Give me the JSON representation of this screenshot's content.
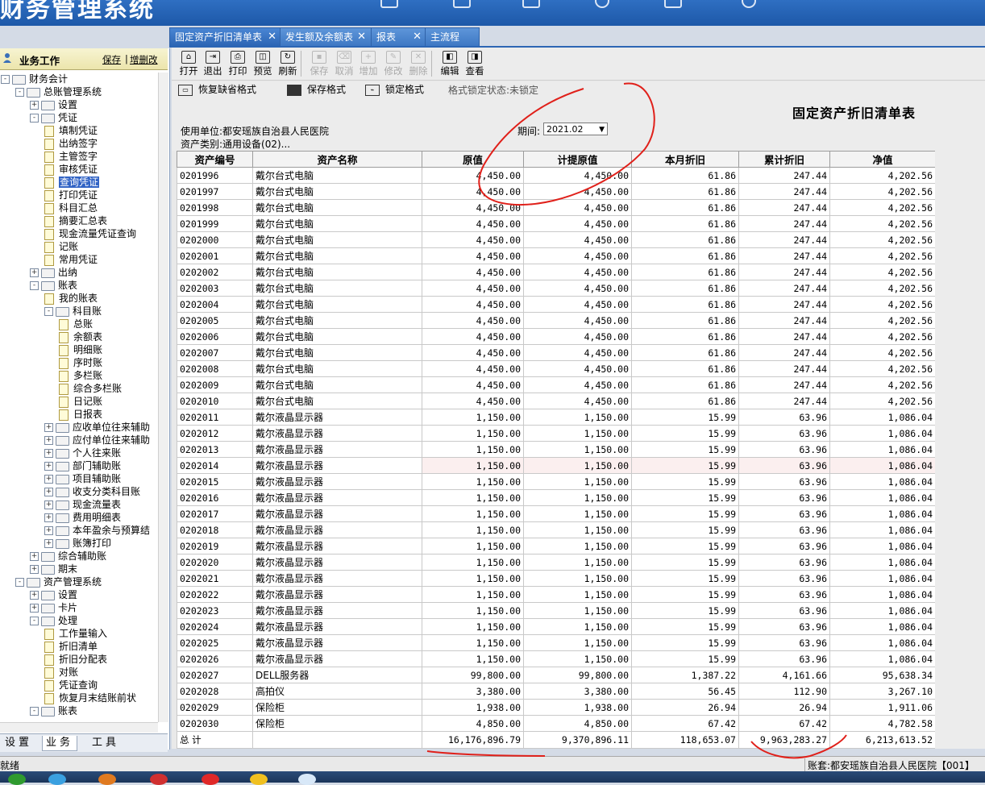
{
  "app": {
    "title": "财务管理系统"
  },
  "sidebar": {
    "title": "业务工作",
    "save_link": "保存",
    "separator": "|",
    "edit_link": "增删改",
    "tree": [
      {
        "label": "财务会计",
        "level": 0,
        "type": "folder",
        "exp": "-"
      },
      {
        "label": "总账管理系统",
        "level": 1,
        "type": "folder",
        "exp": "-"
      },
      {
        "label": "设置",
        "level": 2,
        "type": "folder",
        "exp": "+"
      },
      {
        "label": "凭证",
        "level": 2,
        "type": "folder",
        "exp": "-"
      },
      {
        "label": "填制凭证",
        "level": 3,
        "type": "doc"
      },
      {
        "label": "出纳签字",
        "level": 3,
        "type": "doc"
      },
      {
        "label": "主管签字",
        "level": 3,
        "type": "doc"
      },
      {
        "label": "审核凭证",
        "level": 3,
        "type": "doc"
      },
      {
        "label": "查询凭证",
        "level": 3,
        "type": "doc",
        "selected": true
      },
      {
        "label": "打印凭证",
        "level": 3,
        "type": "doc"
      },
      {
        "label": "科目汇总",
        "level": 3,
        "type": "doc"
      },
      {
        "label": "摘要汇总表",
        "level": 3,
        "type": "doc"
      },
      {
        "label": "现金流量凭证查询",
        "level": 3,
        "type": "doc"
      },
      {
        "label": "记账",
        "level": 3,
        "type": "doc"
      },
      {
        "label": "常用凭证",
        "level": 3,
        "type": "doc"
      },
      {
        "label": "出纳",
        "level": 2,
        "type": "folder",
        "exp": "+"
      },
      {
        "label": "账表",
        "level": 2,
        "type": "folder",
        "exp": "-"
      },
      {
        "label": "我的账表",
        "level": 3,
        "type": "doc"
      },
      {
        "label": "科目账",
        "level": 3,
        "type": "folder",
        "exp": "-"
      },
      {
        "label": "总账",
        "level": 4,
        "type": "doc"
      },
      {
        "label": "余额表",
        "level": 4,
        "type": "doc"
      },
      {
        "label": "明细账",
        "level": 4,
        "type": "doc"
      },
      {
        "label": "序时账",
        "level": 4,
        "type": "doc"
      },
      {
        "label": "多栏账",
        "level": 4,
        "type": "doc"
      },
      {
        "label": "综合多栏账",
        "level": 4,
        "type": "doc"
      },
      {
        "label": "日记账",
        "level": 4,
        "type": "doc"
      },
      {
        "label": "日报表",
        "level": 4,
        "type": "doc"
      },
      {
        "label": "应收单位往来辅助",
        "level": 3,
        "type": "folder",
        "exp": "+"
      },
      {
        "label": "应付单位往来辅助",
        "level": 3,
        "type": "folder",
        "exp": "+"
      },
      {
        "label": "个人往来账",
        "level": 3,
        "type": "folder",
        "exp": "+"
      },
      {
        "label": "部门辅助账",
        "level": 3,
        "type": "folder",
        "exp": "+"
      },
      {
        "label": "项目辅助账",
        "level": 3,
        "type": "folder",
        "exp": "+"
      },
      {
        "label": "收支分类科目账",
        "level": 3,
        "type": "folder",
        "exp": "+"
      },
      {
        "label": "现金流量表",
        "level": 3,
        "type": "folder",
        "exp": "+"
      },
      {
        "label": "费用明细表",
        "level": 3,
        "type": "folder",
        "exp": "+"
      },
      {
        "label": "本年盈余与预算结",
        "level": 3,
        "type": "folder",
        "exp": "+"
      },
      {
        "label": "账簿打印",
        "level": 3,
        "type": "folder",
        "exp": "+"
      },
      {
        "label": "综合辅助账",
        "level": 2,
        "type": "folder",
        "exp": "+"
      },
      {
        "label": "期末",
        "level": 2,
        "type": "folder",
        "exp": "+"
      },
      {
        "label": "资产管理系统",
        "level": 1,
        "type": "folder",
        "exp": "-"
      },
      {
        "label": "设置",
        "level": 2,
        "type": "folder",
        "exp": "+"
      },
      {
        "label": "卡片",
        "level": 2,
        "type": "folder",
        "exp": "+"
      },
      {
        "label": "处理",
        "level": 2,
        "type": "folder",
        "exp": "-"
      },
      {
        "label": "工作量输入",
        "level": 3,
        "type": "doc"
      },
      {
        "label": "折旧清单",
        "level": 3,
        "type": "doc"
      },
      {
        "label": "折旧分配表",
        "level": 3,
        "type": "doc"
      },
      {
        "label": "对账",
        "level": 3,
        "type": "doc"
      },
      {
        "label": "凭证查询",
        "level": 3,
        "type": "doc"
      },
      {
        "label": "恢复月末结账前状",
        "level": 3,
        "type": "doc"
      },
      {
        "label": "账表",
        "level": 2,
        "type": "folder",
        "exp": "-"
      }
    ],
    "bottom_tabs": [
      "设置",
      "业务",
      "工具"
    ],
    "active_tab": 1
  },
  "doc_tabs": [
    {
      "label": "固定资产折旧清单表",
      "active": true
    },
    {
      "label": "发生额及余额表"
    },
    {
      "label": "报表"
    },
    {
      "label": "主流程",
      "no_close": true
    }
  ],
  "toolbar": [
    {
      "label": "打开",
      "icon": "open-icon"
    },
    {
      "label": "退出",
      "icon": "exit-icon"
    },
    {
      "label": "打印",
      "icon": "print-icon"
    },
    {
      "label": "预览",
      "icon": "preview-icon"
    },
    {
      "label": "刷新",
      "icon": "refresh-icon"
    },
    {
      "label": "保存",
      "icon": "save-icon",
      "disabled": true
    },
    {
      "label": "取消",
      "icon": "cancel-icon",
      "disabled": true
    },
    {
      "label": "增加",
      "icon": "add-icon",
      "disabled": true
    },
    {
      "label": "修改",
      "icon": "edit-icon",
      "disabled": true
    },
    {
      "label": "删除",
      "icon": "delete-icon",
      "disabled": true
    },
    {
      "label": "编辑",
      "icon": "design-icon"
    },
    {
      "label": "查看",
      "icon": "view-icon"
    }
  ],
  "format_bar": {
    "restore_label": "恢复缺省格式",
    "save_label": "保存格式",
    "lock_label": "锁定格式",
    "status": "格式锁定状态:未锁定"
  },
  "report": {
    "title": "固定资产折旧清单表",
    "unit": "使用单位:都安瑶族自治县人民医院",
    "period_label": "期间:",
    "period_value": "2021.02",
    "category": "资产类别:通用设备(02)..."
  },
  "table": {
    "columns": [
      "资产编号",
      "资产名称",
      "原值",
      "计提原值",
      "本月折旧",
      "累计折旧",
      "净值"
    ],
    "rows": [
      [
        "0201996",
        "戴尔台式电脑",
        "4,450.00",
        "4,450.00",
        "61.86",
        "247.44",
        "4,202.56"
      ],
      [
        "0201997",
        "戴尔台式电脑",
        "4,450.00",
        "4,450.00",
        "61.86",
        "247.44",
        "4,202.56"
      ],
      [
        "0201998",
        "戴尔台式电脑",
        "4,450.00",
        "4,450.00",
        "61.86",
        "247.44",
        "4,202.56"
      ],
      [
        "0201999",
        "戴尔台式电脑",
        "4,450.00",
        "4,450.00",
        "61.86",
        "247.44",
        "4,202.56"
      ],
      [
        "0202000",
        "戴尔台式电脑",
        "4,450.00",
        "4,450.00",
        "61.86",
        "247.44",
        "4,202.56"
      ],
      [
        "0202001",
        "戴尔台式电脑",
        "4,450.00",
        "4,450.00",
        "61.86",
        "247.44",
        "4,202.56"
      ],
      [
        "0202002",
        "戴尔台式电脑",
        "4,450.00",
        "4,450.00",
        "61.86",
        "247.44",
        "4,202.56"
      ],
      [
        "0202003",
        "戴尔台式电脑",
        "4,450.00",
        "4,450.00",
        "61.86",
        "247.44",
        "4,202.56"
      ],
      [
        "0202004",
        "戴尔台式电脑",
        "4,450.00",
        "4,450.00",
        "61.86",
        "247.44",
        "4,202.56"
      ],
      [
        "0202005",
        "戴尔台式电脑",
        "4,450.00",
        "4,450.00",
        "61.86",
        "247.44",
        "4,202.56"
      ],
      [
        "0202006",
        "戴尔台式电脑",
        "4,450.00",
        "4,450.00",
        "61.86",
        "247.44",
        "4,202.56"
      ],
      [
        "0202007",
        "戴尔台式电脑",
        "4,450.00",
        "4,450.00",
        "61.86",
        "247.44",
        "4,202.56"
      ],
      [
        "0202008",
        "戴尔台式电脑",
        "4,450.00",
        "4,450.00",
        "61.86",
        "247.44",
        "4,202.56"
      ],
      [
        "0202009",
        "戴尔台式电脑",
        "4,450.00",
        "4,450.00",
        "61.86",
        "247.44",
        "4,202.56"
      ],
      [
        "0202010",
        "戴尔台式电脑",
        "4,450.00",
        "4,450.00",
        "61.86",
        "247.44",
        "4,202.56"
      ],
      [
        "0202011",
        "戴尔液晶显示器",
        "1,150.00",
        "1,150.00",
        "15.99",
        "63.96",
        "1,086.04"
      ],
      [
        "0202012",
        "戴尔液晶显示器",
        "1,150.00",
        "1,150.00",
        "15.99",
        "63.96",
        "1,086.04"
      ],
      [
        "0202013",
        "戴尔液晶显示器",
        "1,150.00",
        "1,150.00",
        "15.99",
        "63.96",
        "1,086.04"
      ],
      [
        "0202014",
        "戴尔液晶显示器",
        "1,150.00",
        "1,150.00",
        "15.99",
        "63.96",
        "1,086.04"
      ],
      [
        "0202015",
        "戴尔液晶显示器",
        "1,150.00",
        "1,150.00",
        "15.99",
        "63.96",
        "1,086.04"
      ],
      [
        "0202016",
        "戴尔液晶显示器",
        "1,150.00",
        "1,150.00",
        "15.99",
        "63.96",
        "1,086.04"
      ],
      [
        "0202017",
        "戴尔液晶显示器",
        "1,150.00",
        "1,150.00",
        "15.99",
        "63.96",
        "1,086.04"
      ],
      [
        "0202018",
        "戴尔液晶显示器",
        "1,150.00",
        "1,150.00",
        "15.99",
        "63.96",
        "1,086.04"
      ],
      [
        "0202019",
        "戴尔液晶显示器",
        "1,150.00",
        "1,150.00",
        "15.99",
        "63.96",
        "1,086.04"
      ],
      [
        "0202020",
        "戴尔液晶显示器",
        "1,150.00",
        "1,150.00",
        "15.99",
        "63.96",
        "1,086.04"
      ],
      [
        "0202021",
        "戴尔液晶显示器",
        "1,150.00",
        "1,150.00",
        "15.99",
        "63.96",
        "1,086.04"
      ],
      [
        "0202022",
        "戴尔液晶显示器",
        "1,150.00",
        "1,150.00",
        "15.99",
        "63.96",
        "1,086.04"
      ],
      [
        "0202023",
        "戴尔液晶显示器",
        "1,150.00",
        "1,150.00",
        "15.99",
        "63.96",
        "1,086.04"
      ],
      [
        "0202024",
        "戴尔液晶显示器",
        "1,150.00",
        "1,150.00",
        "15.99",
        "63.96",
        "1,086.04"
      ],
      [
        "0202025",
        "戴尔液晶显示器",
        "1,150.00",
        "1,150.00",
        "15.99",
        "63.96",
        "1,086.04"
      ],
      [
        "0202026",
        "戴尔液晶显示器",
        "1,150.00",
        "1,150.00",
        "15.99",
        "63.96",
        "1,086.04"
      ],
      [
        "0202027",
        "DELL服务器",
        "99,800.00",
        "99,800.00",
        "1,387.22",
        "4,161.66",
        "95,638.34"
      ],
      [
        "0202028",
        "高拍仪",
        "3,380.00",
        "3,380.00",
        "56.45",
        "112.90",
        "3,267.10"
      ],
      [
        "0202029",
        "保险柜",
        "1,938.00",
        "1,938.00",
        "26.94",
        "26.94",
        "1,911.06"
      ],
      [
        "0202030",
        "保险柜",
        "4,850.00",
        "4,850.00",
        "67.42",
        "67.42",
        "4,782.58"
      ]
    ],
    "highlight_row": 18,
    "total": [
      "总 计",
      "",
      "16,176,896.79",
      "9,370,896.11",
      "118,653.07",
      "9,963,283.27",
      "6,213,613.52"
    ]
  },
  "status": {
    "left": "就绪",
    "right": "账套:都安瑶族自治县人民医院【001】"
  },
  "colors": {
    "accent": "#2c65b4",
    "annotation": "#e0201a"
  }
}
